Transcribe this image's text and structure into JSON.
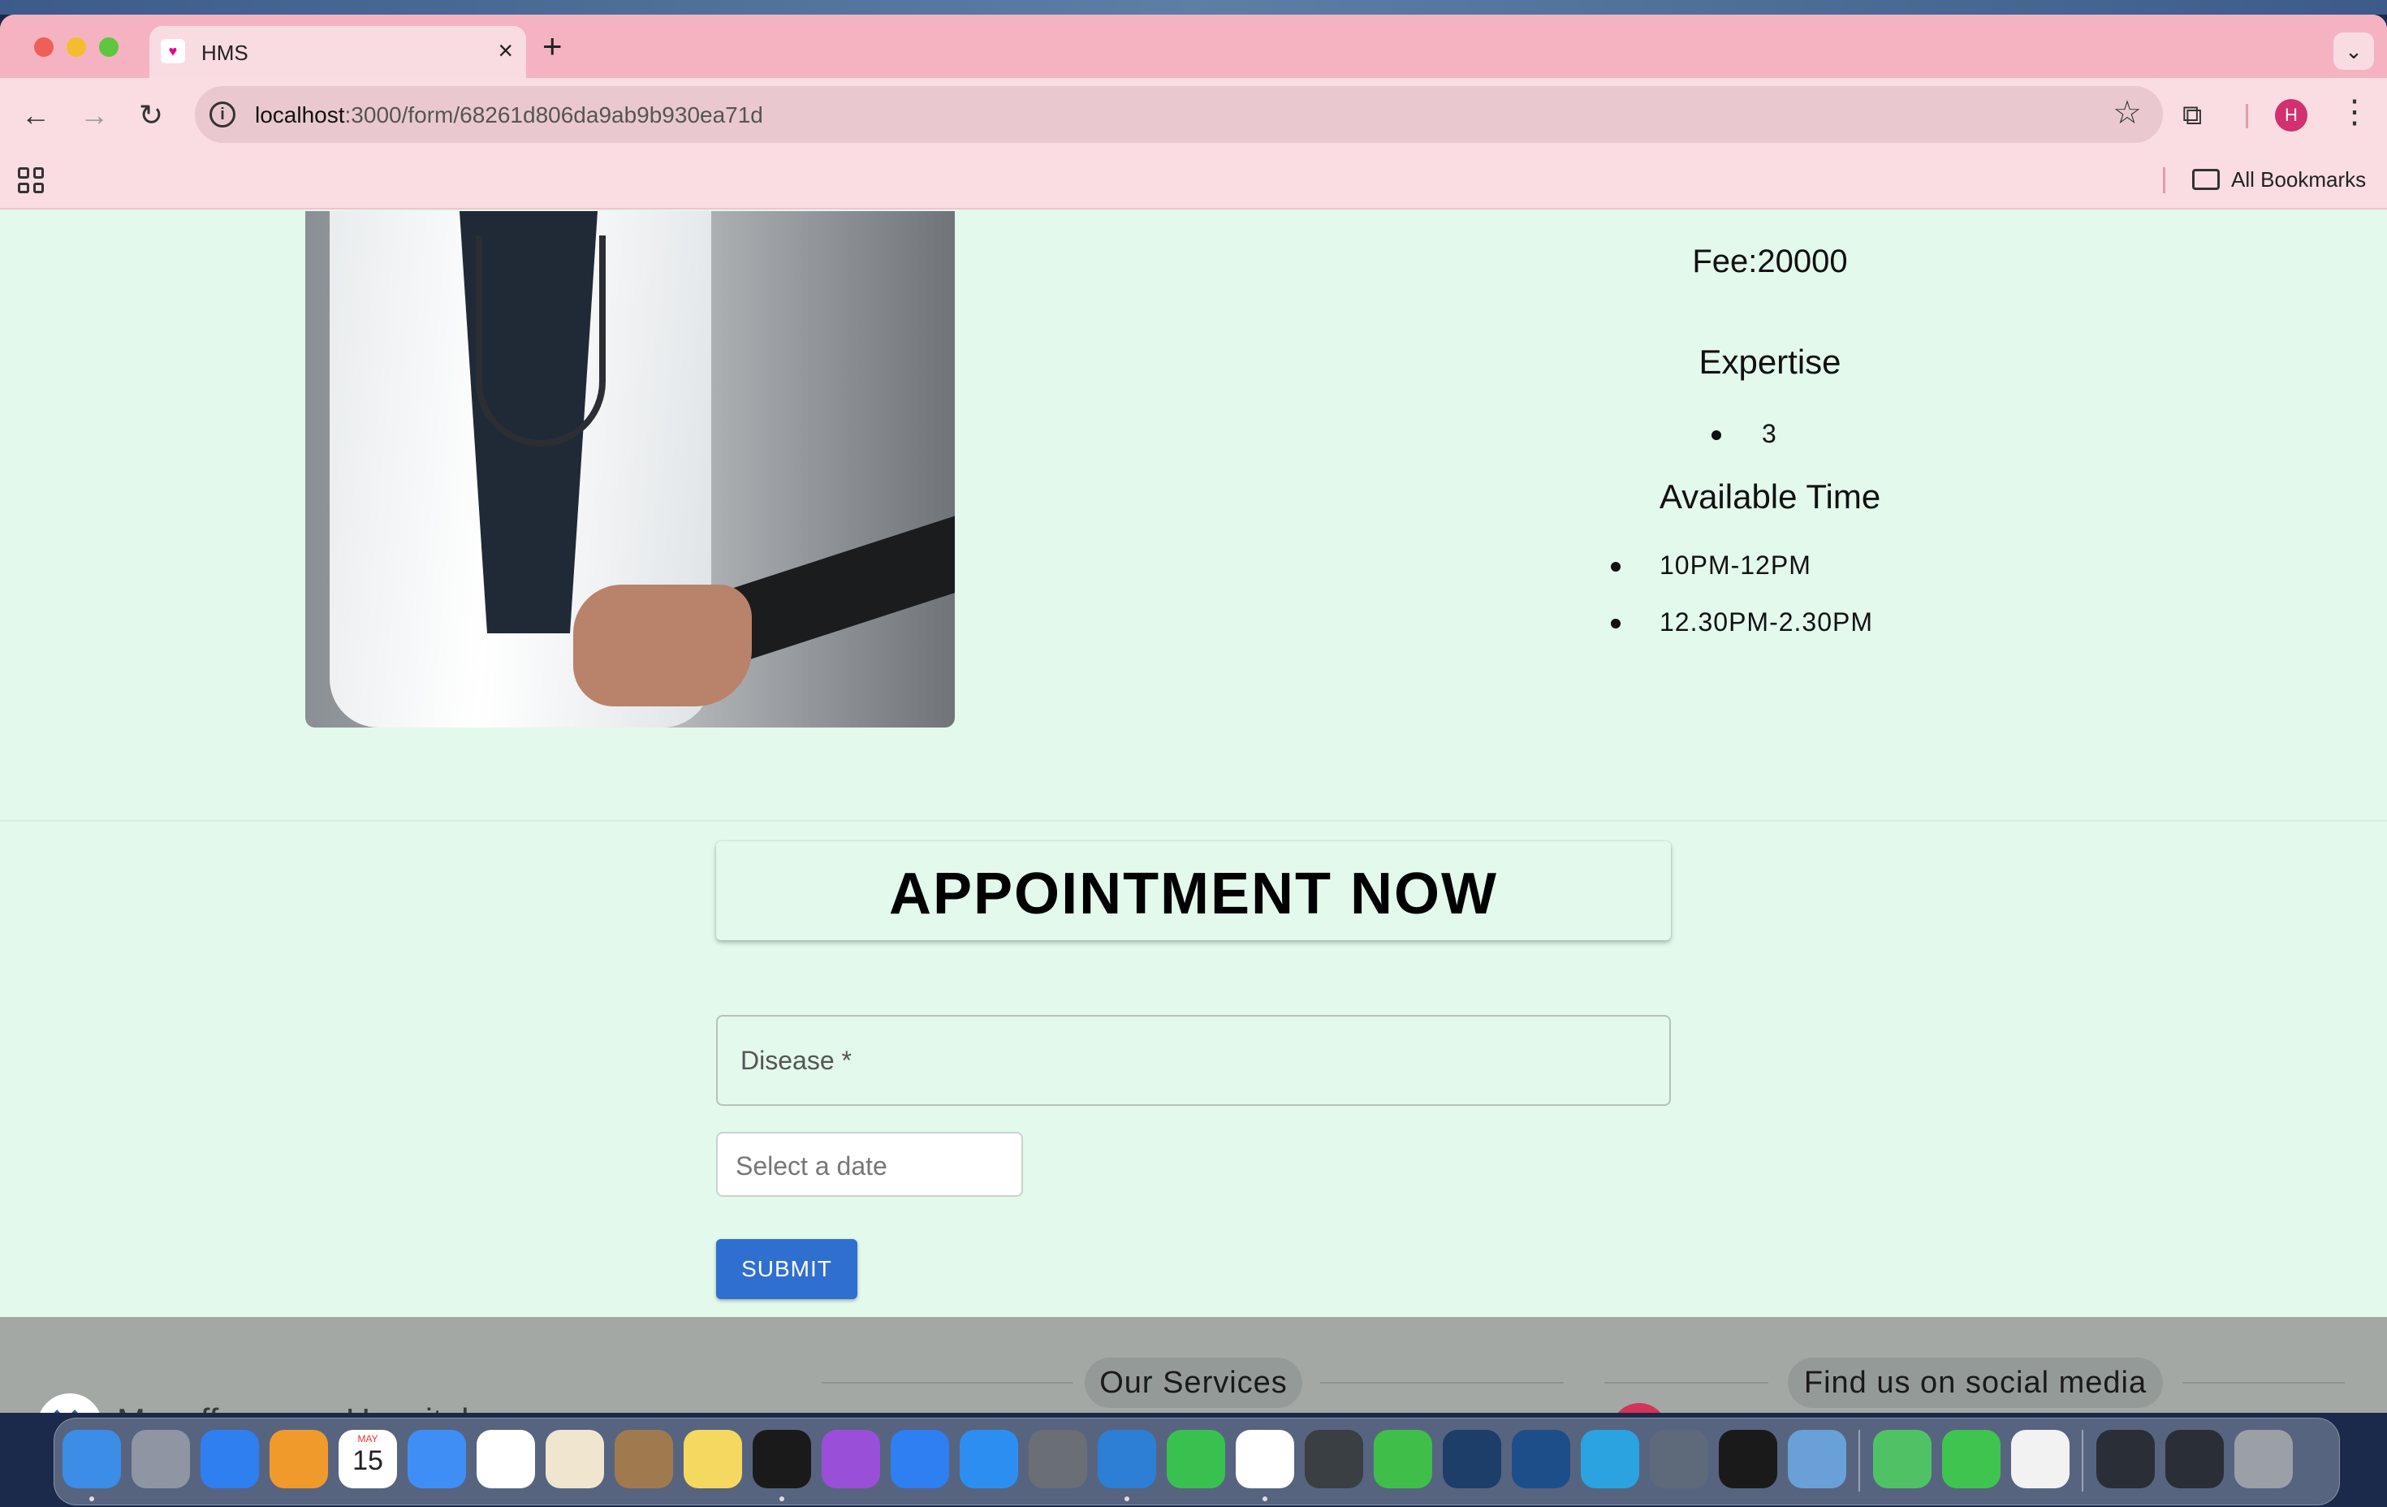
{
  "browser": {
    "tab_title": "HMS",
    "tab_close": "×",
    "new_tab": "+",
    "tab_menu": "⌄",
    "url_host": "localhost",
    "url_path": ":3000/form/68261d806da9ab9b930ea71d",
    "avatar_initial": "H",
    "bookmarks_label": "All Bookmarks",
    "icons": {
      "back": "arrow-left-icon",
      "forward": "arrow-right-icon",
      "reload": "reload-icon",
      "info": "info-icon",
      "star": "star-icon",
      "extensions": "puzzle-icon",
      "menu": "kebab-icon",
      "apps": "apps-grid-icon",
      "folder": "folder-icon"
    },
    "colors": {
      "tabbar": "#f5b3c2",
      "toolbar": "#f9dde3",
      "avatar": "#d2306e"
    }
  },
  "doctor": {
    "fee": "Fee:20000",
    "expertise_heading": "Expertise",
    "expertise": [
      "3"
    ],
    "available_heading": "Available Time",
    "times": [
      "10PM-12PM",
      "12.30PM-2.30PM"
    ]
  },
  "appointment": {
    "title": "APPOINTMENT NOW",
    "disease_label": "Disease *",
    "date_placeholder": "Select a date",
    "submit_label": "SUBMIT",
    "colors": {
      "page_bg": "#e2f9ec",
      "submit_bg": "#2f6fcf"
    }
  },
  "footer": {
    "hospital_name": "Muzaffarnagar Hospital",
    "services_heading": "Our Services",
    "social_heading": "Find us on social media"
  },
  "dock": {
    "apps": [
      "finder-icon",
      "launchpad-icon",
      "safari-icon",
      "pages-icon",
      "calendar-icon",
      "mail-icon",
      "reminders-icon",
      "photos-icon",
      "contacts-icon",
      "notes-icon",
      "terminal-icon",
      "podcasts-icon",
      "keynote-icon",
      "app-store-icon",
      "system-settings-icon",
      "vscode-icon",
      "facetime-icon",
      "chrome-icon",
      "quicktime-icon",
      "numbers-icon",
      "cloud-app-icon",
      "gem-app-icon",
      "telegram-icon",
      "iphone-mirroring-icon",
      "activity-monitor-icon",
      "database-app-icon",
      "find-my-icon",
      "whatsapp-icon",
      "textedit-icon",
      "window-thumbnail-icon",
      "window-thumbnail-icon",
      "trash-icon"
    ],
    "calendar_month": "MAY",
    "calendar_day": "15"
  }
}
